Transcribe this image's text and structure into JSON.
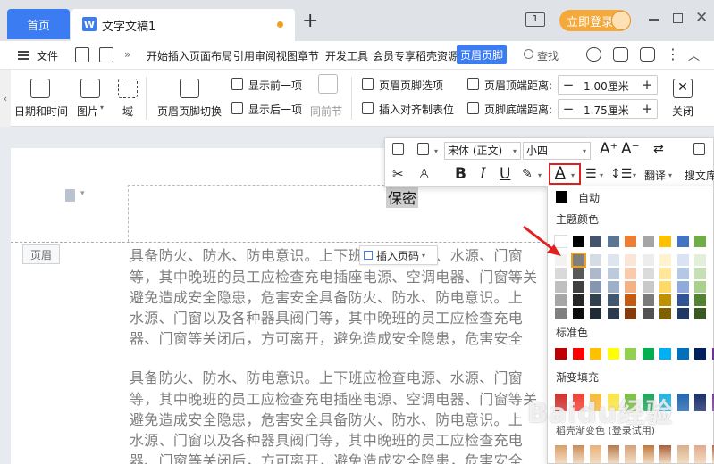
{
  "tabbar": {
    "home_label": "首页",
    "doc_icon": "W",
    "doc_title": "文字文稿1",
    "new_tab": "+",
    "window_switch": "1",
    "login_label": "立即登录"
  },
  "menu": {
    "file_label": "文件",
    "more": "»",
    "items": [
      "开始",
      "插入",
      "页面布局",
      "引用",
      "审阅",
      "视图",
      "章节",
      "开发工具",
      "会员专享",
      "稻壳资源"
    ],
    "active": "页眉页脚",
    "search_label": "查找"
  },
  "ribbon": {
    "date_time": "日期和时间",
    "picture": "图片",
    "domain": "域",
    "switch_hf": "页眉页脚切换",
    "show_prev": "显示前一项",
    "show_next": "显示后一项",
    "same_prev": "同前节",
    "hf_options": "页眉页脚选项",
    "insert_tab": "插入对齐制表位",
    "top_dist_label": "页眉顶端距离:",
    "top_dist_value": "1.00厘米",
    "bottom_dist_label": "页脚底端距离:",
    "bottom_dist_value": "1.75厘米",
    "close": "关闭"
  },
  "float_toolbar": {
    "font_name": "宋体 (正文)",
    "font_size": "小四",
    "bold": "B",
    "italic": "I",
    "underline": "U",
    "font_color": "A",
    "translate": "翻译",
    "search_lib": "搜文库"
  },
  "color_panel": {
    "auto": "自动",
    "theme": "主题颜色",
    "standard": "标准色",
    "gradient": "渐变填充",
    "rainbow": "稻壳渐变色 (登录试用)",
    "theme_top": [
      "#ffffff",
      "#000000",
      "#44546a",
      "#5b7695",
      "#ed7d31",
      "#a5a5a5",
      "#ffc000",
      "#4472c4",
      "#70ad47"
    ],
    "theme_cols": [
      [
        "#f2f2f2",
        "#d9d9d9",
        "#bfbfbf",
        "#a6a6a6",
        "#7f7f7f"
      ],
      [
        "#7f7f7f",
        "#595959",
        "#404040",
        "#262626",
        "#0d0d0d"
      ],
      [
        "#d6dce4",
        "#adb9ca",
        "#8496b0",
        "#323f4f",
        "#222a35"
      ],
      [
        "#dee5ee",
        "#bdcadc",
        "#9cb0ca",
        "#3f5870",
        "#2a3b4b"
      ],
      [
        "#fbe5d6",
        "#f8cbad",
        "#f4b183",
        "#c55a11",
        "#843c0c"
      ],
      [
        "#ededed",
        "#dbdbdb",
        "#c9c9c9",
        "#7b7b7b",
        "#525252"
      ],
      [
        "#fff2cc",
        "#ffe699",
        "#ffd966",
        "#bf9000",
        "#7f6000"
      ],
      [
        "#dae3f3",
        "#b4c7e7",
        "#8faadc",
        "#2f5597",
        "#203864"
      ],
      [
        "#e2f0d9",
        "#c5e0b4",
        "#a9d18e",
        "#548235",
        "#385723"
      ]
    ],
    "standard_colors": [
      "#c00000",
      "#ff0000",
      "#ffc000",
      "#ffff00",
      "#92d050",
      "#00b050",
      "#00b0f0",
      "#0070c0",
      "#002060",
      "#7030a0"
    ],
    "gradient_colors": [
      "#d0312d",
      "#ee4035",
      "#f6b93b",
      "#f9e547",
      "#7bc043",
      "#1fa45a",
      "#22b3e0",
      "#2166b0",
      "#1b2f6b",
      "#7b3fa0"
    ],
    "rainbow_colors": [
      "#d9a066",
      "#c98b5b",
      "#e8b27a",
      "#b7794f",
      "#d6a07a",
      "#c0763f",
      "#a85f3a",
      "#d7b08a",
      "#e3a98d",
      "#b56a4b"
    ]
  },
  "document": {
    "header_tag": "页眉",
    "header_text": "保密",
    "insert_pageno": "插入页码",
    "paragraph1": [
      "具备防火、防水、防电意识。上下班应检查电源、水源、门窗",
      "等，其中晚班的员工应检查充电插座电源、空调电器、门窗等关",
      "避免造成安全隐患，危害安全具备防火、防水、防电意识。上",
      "水源、门窗以及各种器具阀门等，其中晚班的员工应检查充电",
      "器、门窗等关闭后，方可离开，避免造成安全隐患，危害安全"
    ],
    "paragraph2": [
      "具备防火、防水、防电意识。上下班应检查电源、水源、门窗",
      "等，其中晚班的员工应检查充电插座电源、空调电器、门窗等关",
      "避免造成安全隐患，危害安全具备防火、防水、防电意识。上",
      "水源、门窗以及各种器具阀门等，其中晚班的员工应检查充电",
      "器、门窗等关闭后，方可离开，避免造成安全隐患，危害安全"
    ]
  },
  "watermark": "Baidu经验",
  "accent_color": "#3b7cf3",
  "highlight_color": "#e02020"
}
